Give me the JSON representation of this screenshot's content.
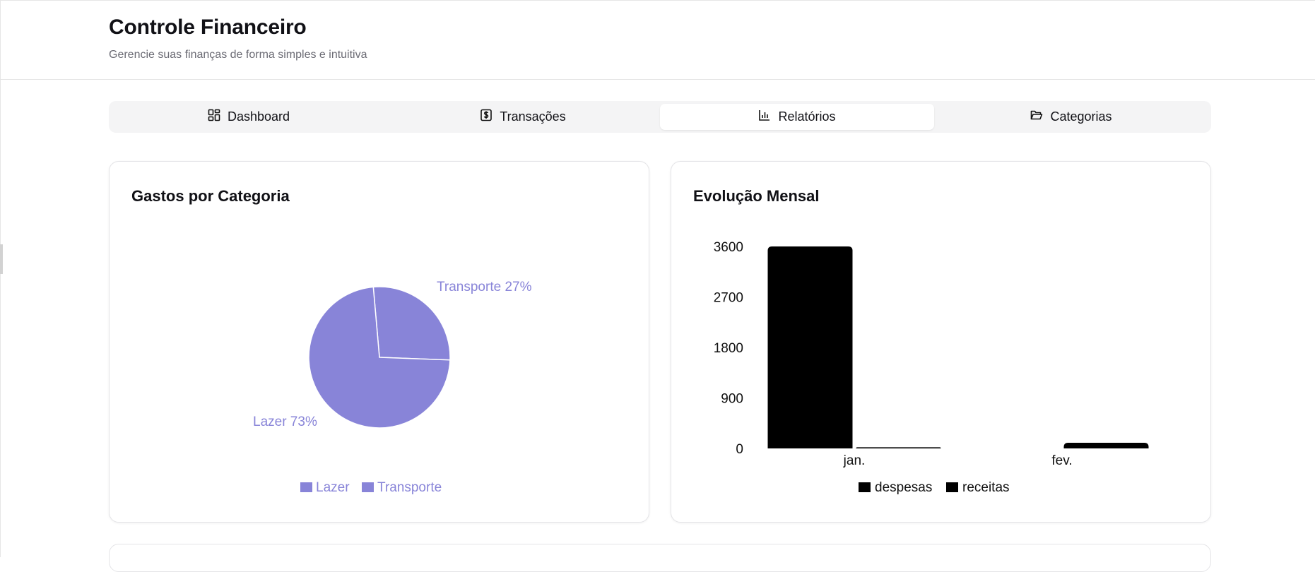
{
  "header": {
    "title": "Controle Financeiro",
    "subtitle": "Gerencie suas finanças de forma simples e intuitiva"
  },
  "tabs": [
    {
      "label": "Dashboard",
      "icon": "dashboard-icon",
      "active": false
    },
    {
      "label": "Transações",
      "icon": "dollar-receipt-icon",
      "active": false
    },
    {
      "label": "Relatórios",
      "icon": "bar-chart-icon",
      "active": true
    },
    {
      "label": "Categorias",
      "icon": "folder-icon",
      "active": false
    }
  ],
  "colors": {
    "pie": "#8884d8",
    "bars": "#000000",
    "text_muted": "#6b6b74"
  },
  "expenses_card": {
    "title": "Gastos por Categoria",
    "chart_data": {
      "type": "pie",
      "categories": [
        "Transporte",
        "Lazer"
      ],
      "values": [
        27,
        73
      ],
      "slice_labels": [
        "Transporte 27%",
        "Lazer 73%"
      ],
      "legend": [
        "Lazer",
        "Transporte"
      ],
      "legend_placement": "bottom",
      "color": "#8884d8"
    }
  },
  "monthly_card": {
    "title": "Evolução Mensal",
    "chart_data": {
      "type": "bar",
      "categories": [
        "jan.",
        "fev."
      ],
      "series": [
        {
          "name": "despesas",
          "values": [
            3600,
            0
          ]
        },
        {
          "name": "receitas",
          "values": [
            20,
            100
          ]
        }
      ],
      "yticks": [
        "0",
        "900",
        "1800",
        "2700",
        "3600"
      ],
      "ylim": [
        0,
        3600
      ],
      "legend_placement": "bottom",
      "grid": false
    }
  }
}
